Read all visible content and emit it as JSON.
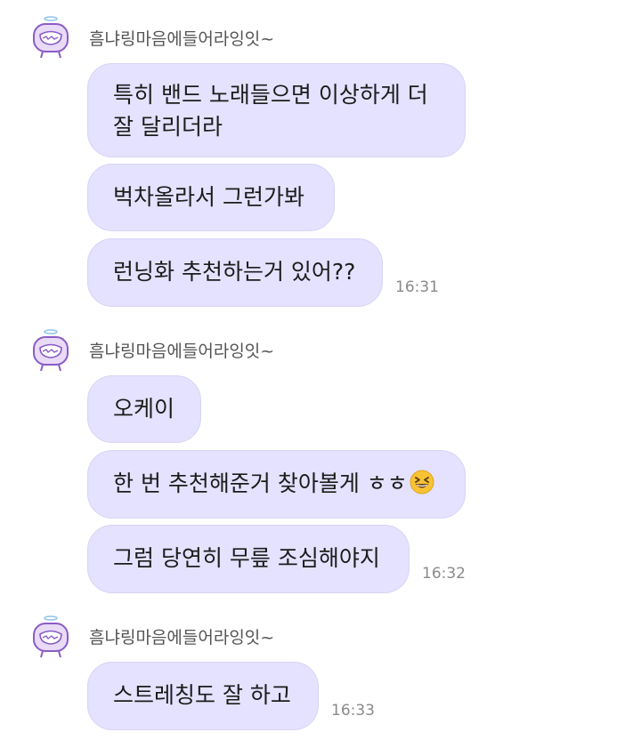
{
  "groups": [
    {
      "sender": "흠냐링마음에들어라잉잇~",
      "messages": [
        {
          "text": "특히 밴드 노래들으면 이상하게 더 잘 달리더라"
        },
        {
          "text": "벅차올라서 그런가봐"
        },
        {
          "text": "런닝화 추천하는거 있어??"
        }
      ],
      "time": "16:31"
    },
    {
      "sender": "흠냐링마음에들어라잉잇~",
      "messages": [
        {
          "text": "오케이"
        },
        {
          "text": "한 번 추천해준거 찾아볼게 ㅎㅎ",
          "emoji": "grinning-squinting-face"
        },
        {
          "text": "그럼 당연히 무릎 조심해야지"
        }
      ],
      "time": "16:32"
    },
    {
      "sender": "흠냐링마음에들어라잉잇~",
      "messages": [
        {
          "text": "스트레칭도 잘 하고"
        }
      ],
      "time": "16:33"
    }
  ],
  "colors": {
    "bubble": "#e4e2fe",
    "bubble_border": "#d7d4f6",
    "avatar_accent": "#8a5cc7"
  },
  "icons": {
    "avatar": "purple-tv-character-with-halo",
    "emoji": "grinning-squinting-face"
  }
}
